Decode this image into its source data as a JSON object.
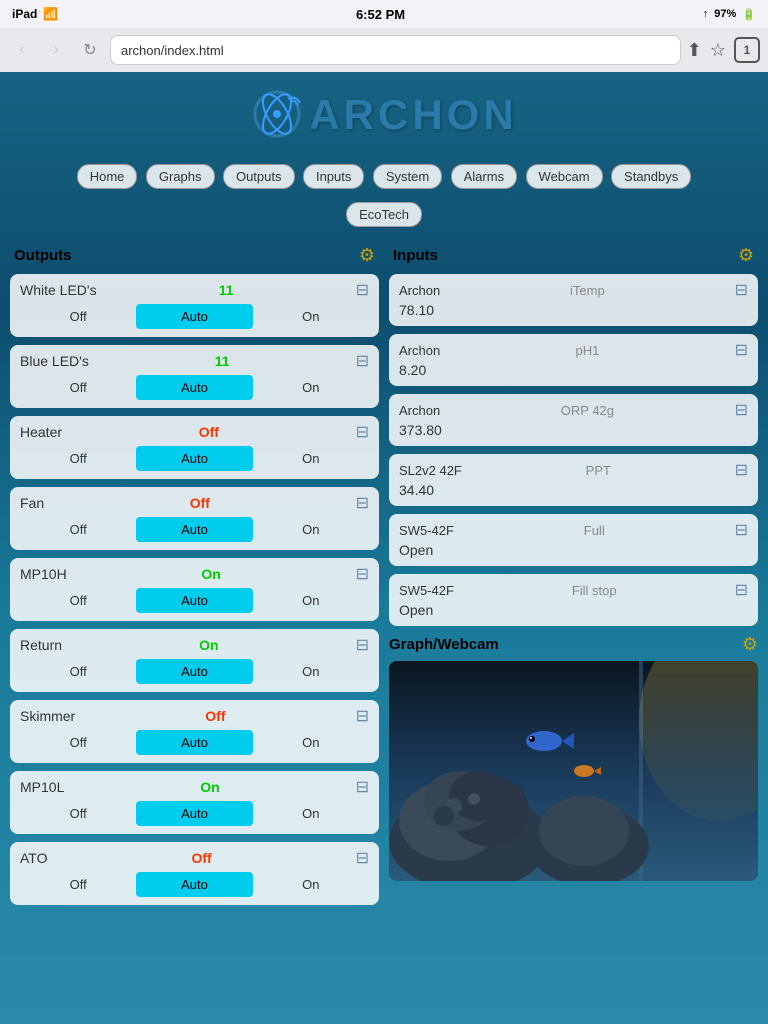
{
  "statusBar": {
    "carrier": "iPad",
    "wifi": true,
    "time": "6:52 PM",
    "signal": "↑",
    "battery": "97%"
  },
  "browser": {
    "url": "archon/index.html",
    "tabCount": "1"
  },
  "header": {
    "logoText": "ARCHON"
  },
  "nav": {
    "items": [
      "Home",
      "Graphs",
      "Outputs",
      "Inputs",
      "System",
      "Alarms",
      "Webcam",
      "Standbys"
    ],
    "sub": [
      "EcoTech"
    ]
  },
  "outputs": {
    "sectionTitle": "Outputs",
    "items": [
      {
        "name": "White LED's",
        "status": "11",
        "statusType": "green",
        "activeControl": "Auto"
      },
      {
        "name": "Blue LED's",
        "status": "11",
        "statusType": "green",
        "activeControl": "Auto"
      },
      {
        "name": "Heater",
        "status": "Off",
        "statusType": "red",
        "activeControl": "Auto"
      },
      {
        "name": "Fan",
        "status": "Off",
        "statusType": "red",
        "activeControl": "Auto"
      },
      {
        "name": "MP10H",
        "status": "On",
        "statusType": "green",
        "activeControl": "Auto"
      },
      {
        "name": "Return",
        "status": "On",
        "statusType": "green",
        "activeControl": "Auto"
      },
      {
        "name": "Skimmer",
        "status": "Off",
        "statusType": "red",
        "activeControl": "Auto"
      },
      {
        "name": "MP10L",
        "status": "On",
        "statusType": "green",
        "activeControl": "Auto"
      },
      {
        "name": "ATO",
        "status": "Off",
        "statusType": "red",
        "activeControl": "Auto"
      }
    ],
    "controls": [
      "Off",
      "Auto",
      "On"
    ]
  },
  "inputs": {
    "sectionTitle": "Inputs",
    "items": [
      {
        "source": "Archon",
        "name": "iTemp",
        "value": "78.10"
      },
      {
        "source": "Archon",
        "name": "pH1",
        "value": "8.20"
      },
      {
        "source": "Archon",
        "name": "ORP 42g",
        "value": "373.80"
      },
      {
        "source": "SL2v2 42F",
        "name": "PPT",
        "value": "34.40"
      },
      {
        "source": "SW5-42F",
        "name": "Full",
        "value": "Open"
      },
      {
        "source": "SW5-42F",
        "name": "Fill stop",
        "value": "Open"
      }
    ]
  },
  "graphWebcam": {
    "sectionTitle": "Graph/Webcam"
  }
}
